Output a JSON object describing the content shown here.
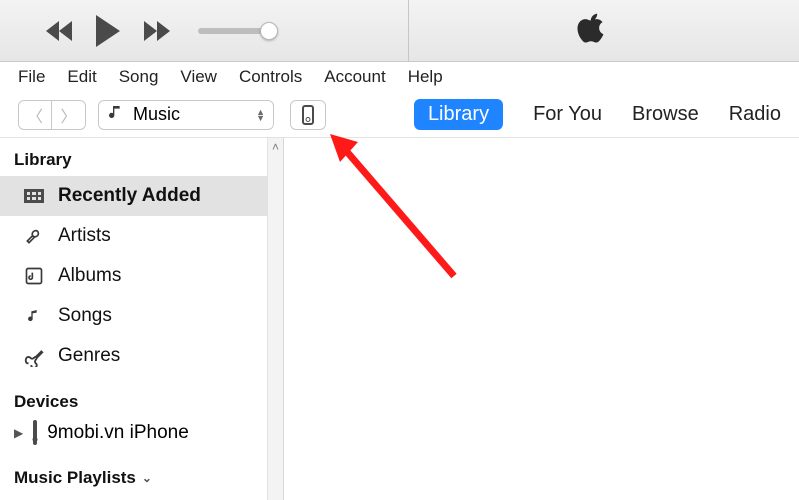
{
  "menubar": [
    "File",
    "Edit",
    "Song",
    "View",
    "Controls",
    "Account",
    "Help"
  ],
  "picker": {
    "label": "Music"
  },
  "tabs": {
    "library": "Library",
    "foryou": "For You",
    "browse": "Browse",
    "radio": "Radio"
  },
  "sidebar": {
    "library_header": "Library",
    "items": [
      {
        "label": "Recently Added"
      },
      {
        "label": "Artists"
      },
      {
        "label": "Albums"
      },
      {
        "label": "Songs"
      },
      {
        "label": "Genres"
      }
    ],
    "devices_header": "Devices",
    "device_name": "9mobi.vn iPhone",
    "playlists_header": "Music Playlists"
  }
}
